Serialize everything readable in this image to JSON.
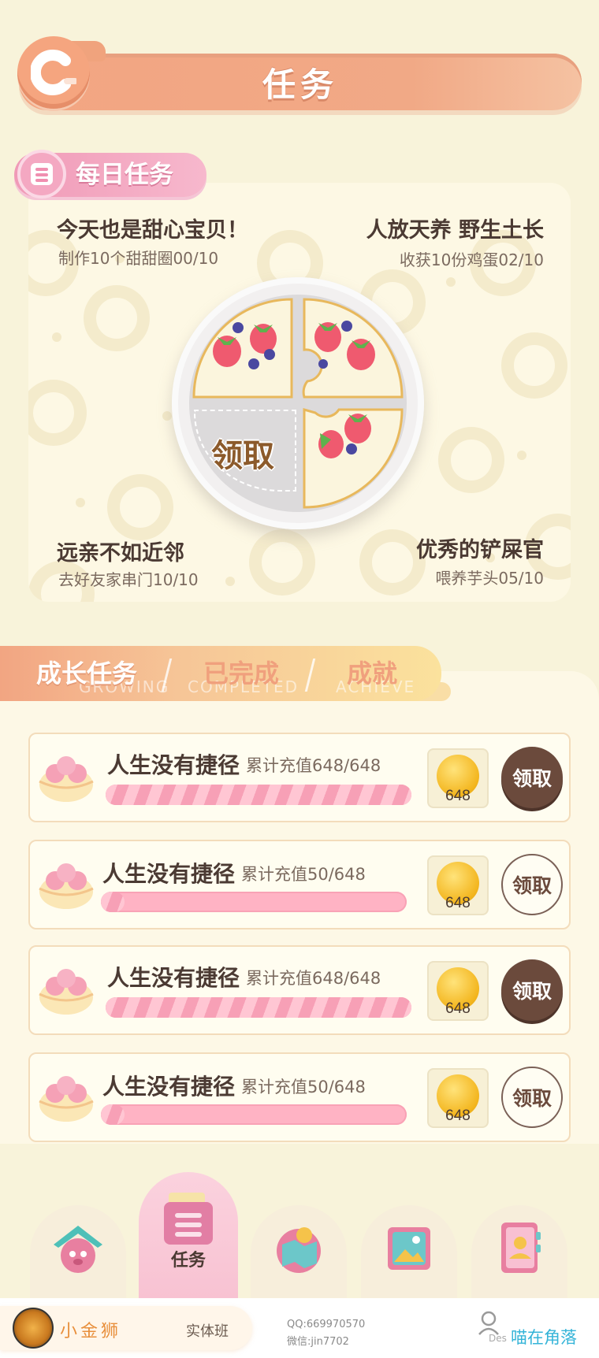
{
  "header": {
    "title": "任务"
  },
  "daily": {
    "title": "每日任务",
    "tasks": [
      {
        "title": "今天也是甜心宝贝！",
        "subtitle": "制作10个甜甜圈00/10"
      },
      {
        "title": "人放天养 野生土长",
        "subtitle": "收获10份鸡蛋02/10"
      },
      {
        "title": "远亲不如近邻",
        "subtitle": "去好友家串门10/10"
      },
      {
        "title": "优秀的铲屎官",
        "subtitle": "喂养芋头05/10"
      }
    ],
    "claim_label": "领取"
  },
  "growth_tabs": [
    {
      "label": "成长任务",
      "ghost": "GROWING",
      "active": true
    },
    {
      "label": "已完成",
      "ghost": "COMPLETED",
      "active": false
    },
    {
      "label": "成就",
      "ghost": "ACHIEVE",
      "active": false
    }
  ],
  "growth_tasks": [
    {
      "name": "人生没有捷径",
      "progress_text": "累计充值648/648",
      "progress": 1.0,
      "reward": "648",
      "button": "领取",
      "claimable": true
    },
    {
      "name": "人生没有捷径",
      "progress_text": "累计充值50/648",
      "progress": 0.077,
      "reward": "648",
      "button": "领取",
      "claimable": false
    },
    {
      "name": "人生没有捷径",
      "progress_text": "累计充值648/648",
      "progress": 1.0,
      "reward": "648",
      "button": "领取",
      "claimable": true
    },
    {
      "name": "人生没有捷径",
      "progress_text": "累计充值50/648",
      "progress": 0.077,
      "reward": "648",
      "button": "领取",
      "claimable": false
    }
  ],
  "bottom_nav": {
    "items": [
      {
        "name": "home-icon",
        "label": ""
      },
      {
        "name": "task-icon",
        "label": "任务",
        "active": true
      },
      {
        "name": "map-icon",
        "label": ""
      },
      {
        "name": "album-icon",
        "label": ""
      },
      {
        "name": "contacts-icon",
        "label": ""
      }
    ]
  },
  "footer": {
    "brand": "小金狮",
    "class": "实体班",
    "qq": "QQ:669970570",
    "wechat": "微信:jin7702",
    "des": "Des",
    "author": "喵在角落"
  },
  "colors": {
    "header": "#f2a784",
    "pink": "#f4a8c2",
    "brown": "#6b4a3c",
    "cream": "#fdf8e4"
  }
}
